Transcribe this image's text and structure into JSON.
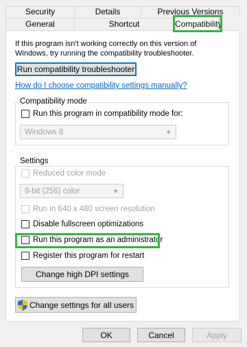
{
  "tabs": {
    "row_back": [
      "Security",
      "Details",
      "Previous Versions"
    ],
    "row_front": [
      "General",
      "Shortcut",
      "Compatibility"
    ],
    "active": "Compatibility"
  },
  "intro": {
    "text": "If this program isn't working correctly on this version of Windows, try running the compatibility troubleshooter."
  },
  "troubleshooter_button": "Run compatibility troubleshooter",
  "manual_link": "How do I choose compatibility settings manually?",
  "compat_mode": {
    "legend": "Compatibility mode",
    "checkbox_label": "Run this program in compatibility mode for:",
    "checked": false,
    "select_value": "Windows 8"
  },
  "settings": {
    "legend": "Settings",
    "reduced_color_label": "Reduced color mode",
    "color_select_value": "8-bit (256) color",
    "resolution_label": "Run in 640 x 480 screen resolution",
    "fullscreen_label": "Disable fullscreen optimizations",
    "admin_label": "Run this program as an administrator",
    "restart_label": "Register this program for restart",
    "dpi_button": "Change high DPI settings"
  },
  "all_users_button": "Change settings for all users",
  "footer": {
    "ok": "OK",
    "cancel": "Cancel",
    "apply": "Apply"
  },
  "highlight_color": "#2cb742"
}
